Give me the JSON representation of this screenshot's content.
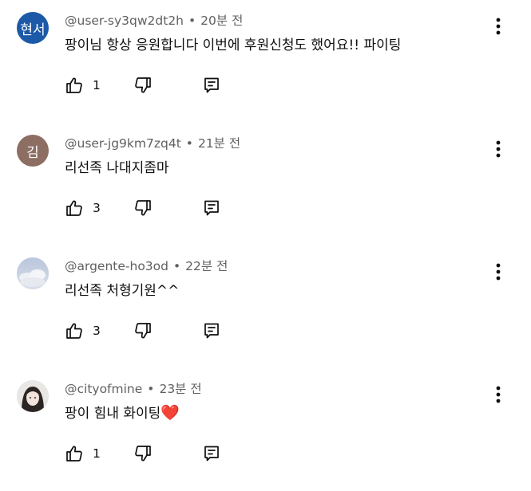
{
  "comments": [
    {
      "author": "@user-sy3qw2dt2h",
      "time": "20분 전",
      "text": "팡이님 항상 응원합니다 이번에 후원신청도 했어요!! 파이팅",
      "likes": "1",
      "avatar_text": "현서",
      "avatar_color": "#1c5aa8"
    },
    {
      "author": "@user-jg9km7zq4t",
      "time": "21분 전",
      "text": "리선족 나대지좀마",
      "likes": "3",
      "avatar_text": "김",
      "avatar_color": "#8d6e63"
    },
    {
      "author": "@argente-ho3od",
      "time": "22분 전",
      "text": "리선족 처형기원^^",
      "likes": "3",
      "avatar_text": "",
      "avatar_color": "#c9d2e4"
    },
    {
      "author": "@cityofmine",
      "time": "23분 전",
      "text": "팡이 힘내 화이팅",
      "text_emoji": "❤️",
      "likes": "1",
      "avatar_text": "",
      "avatar_color": "#e6e4e2"
    }
  ],
  "icons": {
    "like": "thumb-up-icon",
    "dislike": "thumb-down-icon",
    "reply": "reply-icon",
    "more": "more-vertical-icon"
  },
  "colors": {
    "meta_text": "#606060",
    "body_text": "#0f0f0f",
    "heart": "#e0245e"
  }
}
